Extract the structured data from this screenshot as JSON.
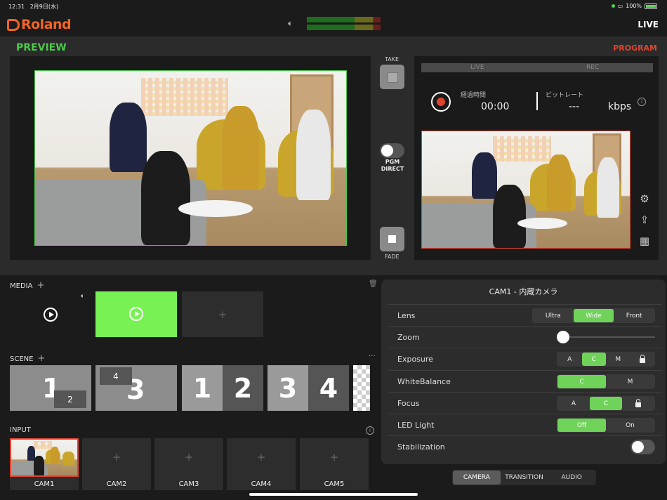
{
  "status": {
    "time": "12:31",
    "date": "2月9日(水)",
    "battery": "100%"
  },
  "header": {
    "logo": "Roland",
    "mode": "LIVE"
  },
  "preview": {
    "title": "PREVIEW"
  },
  "program": {
    "title": "PROGRAM",
    "live_label": "LIVE",
    "rec_label": "REC",
    "elapsed_label": "経過時間",
    "elapsed_value": "00:00",
    "bitrate_label": "ビットレート",
    "bitrate_value": "---",
    "bitrate_unit": "kbps"
  },
  "controls": {
    "take": "TAKE",
    "pgm_direct_1": "PGM",
    "pgm_direct_2": "DIRECT",
    "fade": "FADE"
  },
  "media": {
    "title": "MEDIA"
  },
  "scene": {
    "title": "SCENE",
    "items": [
      {
        "main": "1",
        "sub": "2"
      },
      {
        "main": "3",
        "sub": "4"
      },
      {
        "left": "1",
        "right": "2"
      },
      {
        "left": "3",
        "right": "4"
      }
    ]
  },
  "input": {
    "title": "INPUT",
    "cams": [
      "CAM1",
      "CAM2",
      "CAM3",
      "CAM4",
      "CAM5"
    ]
  },
  "camera_panel": {
    "title": "CAM1 - 内蔵カメラ",
    "lens": {
      "label": "Lens",
      "options": [
        "Ultra",
        "Wide",
        "Front"
      ],
      "selected": "Wide"
    },
    "zoom": {
      "label": "Zoom",
      "value": 0
    },
    "exposure": {
      "label": "Exposure",
      "options": [
        "A",
        "C",
        "M"
      ],
      "selected": "C"
    },
    "whitebalance": {
      "label": "WhiteBalance",
      "options": [
        "C",
        "M"
      ],
      "selected": "C"
    },
    "focus": {
      "label": "Focus",
      "options": [
        "A",
        "C"
      ],
      "selected": "C"
    },
    "led": {
      "label": "LED Light",
      "options": [
        "Off",
        "On"
      ],
      "selected": "Off"
    },
    "stabilization": {
      "label": "Stabilization",
      "on": false
    }
  },
  "bottom_tabs": {
    "items": [
      "CAMERA",
      "TRANSITION",
      "AUDIO"
    ],
    "selected": "CAMERA"
  },
  "colors": {
    "preview": "#4bc94b",
    "program": "#e0442f",
    "accent": "#6fd35a",
    "brand": "#f26522"
  }
}
